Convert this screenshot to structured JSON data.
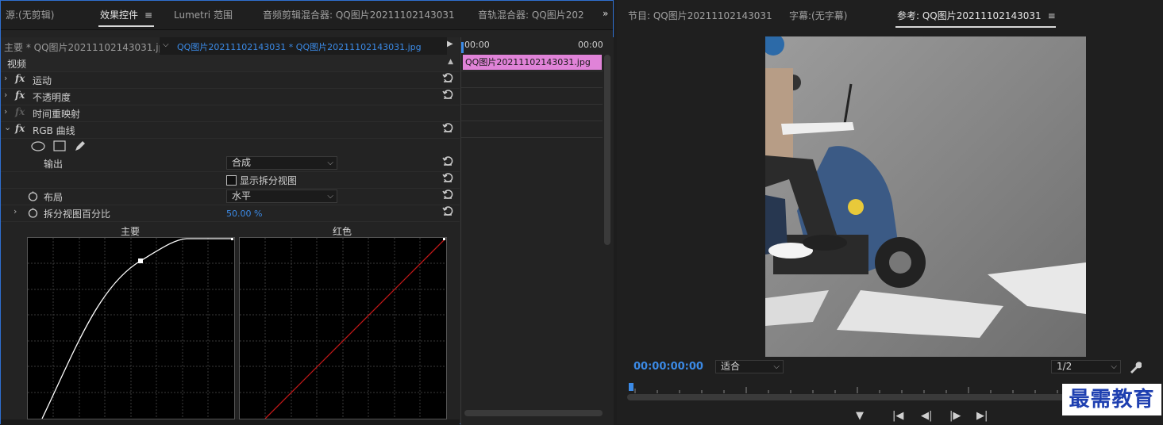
{
  "left_tabs": [
    {
      "label": "源:(无剪辑)",
      "active": false
    },
    {
      "label": "效果控件",
      "active": true
    },
    {
      "label": "Lumetri 范围",
      "active": false
    },
    {
      "label": "音频剪辑混合器: QQ图片20211102143031",
      "active": false
    },
    {
      "label": "音轨混合器: QQ图片202",
      "active": false
    }
  ],
  "more_tabs_glyph": "»",
  "source_label": "主要 * QQ图片20211102143031.jpg",
  "sequence_label": "QQ图片20211102143031 * QQ图片20211102143031.jpg",
  "timeline": {
    "start_time": "00:00",
    "end_time": "00:00",
    "clip_name": "QQ图片20211102143031.jpg"
  },
  "effects": {
    "section": "视频",
    "items": [
      {
        "name": "运动"
      },
      {
        "name": "不透明度"
      },
      {
        "name": "时间重映射"
      },
      {
        "name": "RGB 曲线"
      }
    ],
    "output_label": "输出",
    "output_value": "合成",
    "split_view_label": "显示拆分视图",
    "layout_label": "布局",
    "layout_value": "水平",
    "split_percent_label": "拆分视图百分比",
    "split_percent_value": "50.00 %",
    "curve_main_label": "主要",
    "curve_red_label": "红色"
  },
  "right_tabs": [
    {
      "label": "节目: QQ图片20211102143031",
      "active": false
    },
    {
      "label": "字幕:(无字幕)",
      "active": false
    },
    {
      "label": "参考: QQ图片20211102143031",
      "active": true
    }
  ],
  "monitor": {
    "timecode": "00:00:00:00",
    "fit_value": "适合",
    "scale_value": "1/2"
  },
  "watermark": "最需教育",
  "colors": {
    "accent_blue": "#3b8ae6",
    "clip_pink": "#e083d8",
    "red_curve": "#c01818"
  }
}
